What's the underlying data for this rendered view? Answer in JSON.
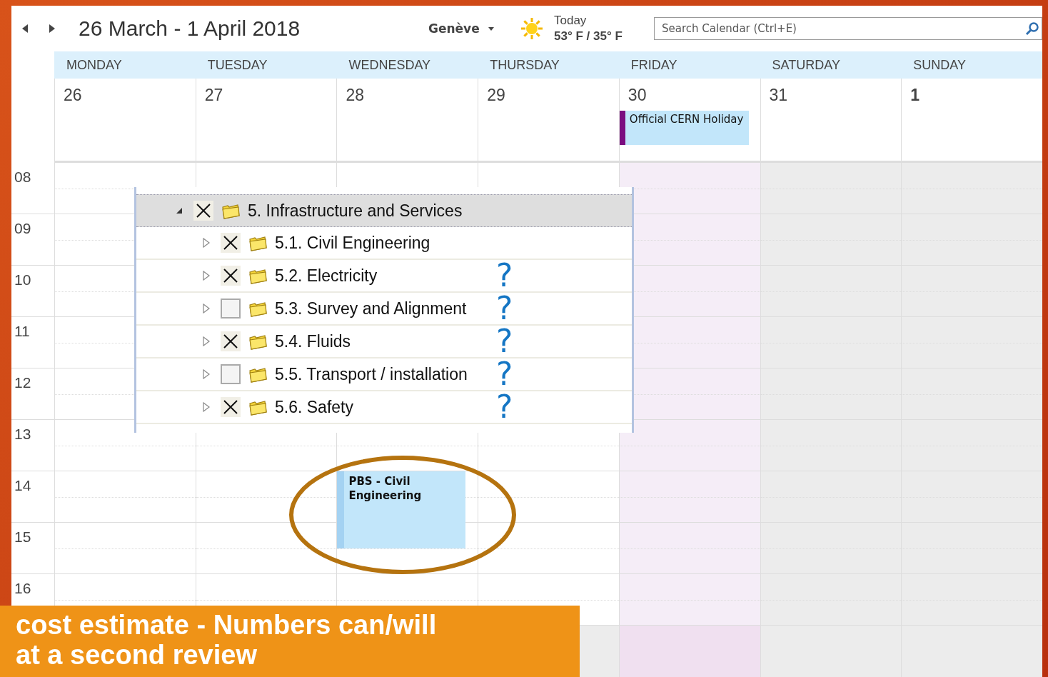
{
  "title": "26 March - 1 April 2018",
  "location": "Genève",
  "weather": {
    "label": "Today",
    "temps": "53° F / 35° F"
  },
  "search": {
    "placeholder": "Search Calendar (Ctrl+E)"
  },
  "days": [
    {
      "name": "MONDAY",
      "date": "26",
      "kind": "weekday",
      "month_start": false
    },
    {
      "name": "TUESDAY",
      "date": "27",
      "kind": "weekday",
      "month_start": false
    },
    {
      "name": "WEDNESDAY",
      "date": "28",
      "kind": "weekday",
      "month_start": false,
      "events": [
        {
          "title": "PBS - Civil Engineering"
        }
      ]
    },
    {
      "name": "THURSDAY",
      "date": "29",
      "kind": "weekday",
      "month_start": false
    },
    {
      "name": "FRIDAY",
      "date": "30",
      "kind": "holiday",
      "month_start": false,
      "all_day": [
        {
          "title": "Official CERN Holiday",
          "color": "#7b0d80"
        }
      ]
    },
    {
      "name": "SATURDAY",
      "date": "31",
      "kind": "weekend",
      "month_start": false
    },
    {
      "name": "SUNDAY",
      "date": "1",
      "kind": "weekend",
      "month_start": true
    }
  ],
  "hours": [
    "08",
    "09",
    "10",
    "11",
    "12",
    "13",
    "14",
    "15",
    "16"
  ],
  "tree": {
    "label": "5. Infrastructure and Services",
    "expanded": true,
    "crossed": true,
    "children": [
      {
        "label": "5.1. Civil Engineering",
        "expanded": false,
        "crossed": true
      },
      {
        "label": "5.2. Electricity",
        "expanded": false,
        "crossed": true,
        "note": "?"
      },
      {
        "label": "5.3. Survey and Alignment",
        "expanded": false,
        "crossed": false,
        "note": "?"
      },
      {
        "label": "5.4. Fluids",
        "expanded": false,
        "crossed": true,
        "note": "?"
      },
      {
        "label": "5.5. Transport / installation",
        "expanded": false,
        "crossed": false,
        "note": "?"
      },
      {
        "label": "5.6. Safety",
        "expanded": false,
        "crossed": true,
        "note": "?"
      }
    ]
  },
  "caption": [
    "cost estimate - Numbers can/will",
    "at a second review"
  ]
}
